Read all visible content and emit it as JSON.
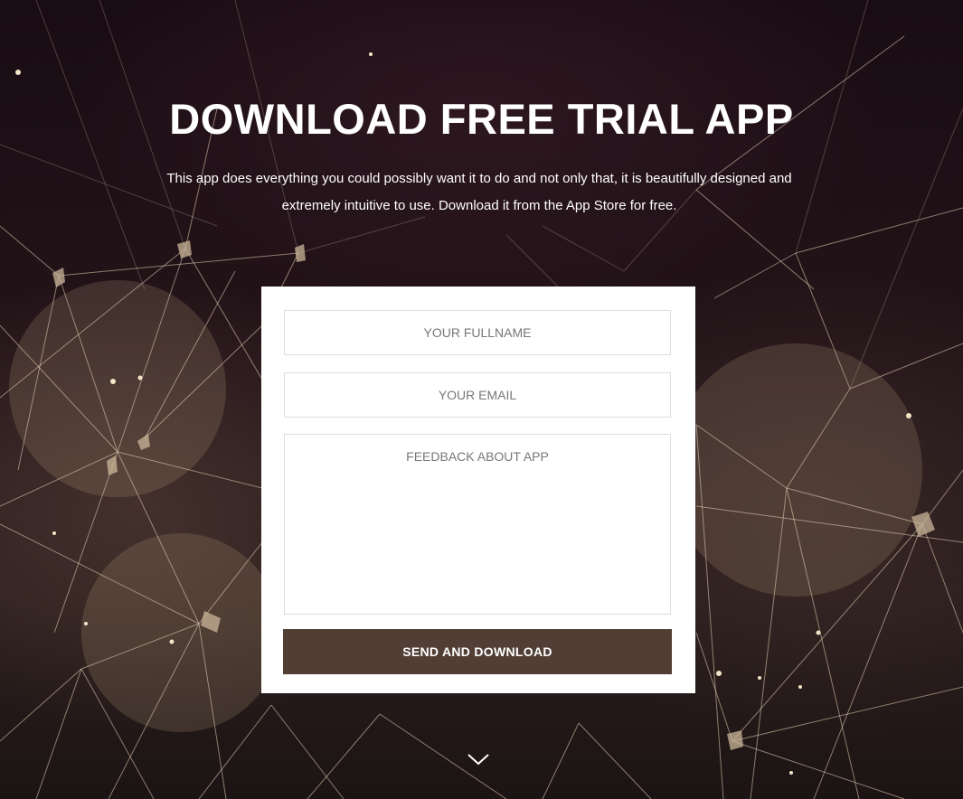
{
  "hero": {
    "title": "DOWNLOAD FREE TRIAL APP",
    "subtitle": "This app does everything you could possibly want it to do and not only that, it is beautifully designed and extremely intuitive to use.  Download it from the App Store for free.",
    "background_icon": "network-graph-background",
    "scroll_icon": "chevron-down-icon"
  },
  "form": {
    "fullname_placeholder": "YOUR FULLNAME",
    "email_placeholder": "YOUR EMAIL",
    "feedback_placeholder": "FEEDBACK ABOUT APP",
    "submit_label": "SEND AND DOWNLOAD"
  },
  "colors": {
    "background": "#1e1116",
    "card": "#ffffff",
    "button": "#513f35",
    "text_light": "#ffffff",
    "placeholder": "#777777"
  }
}
